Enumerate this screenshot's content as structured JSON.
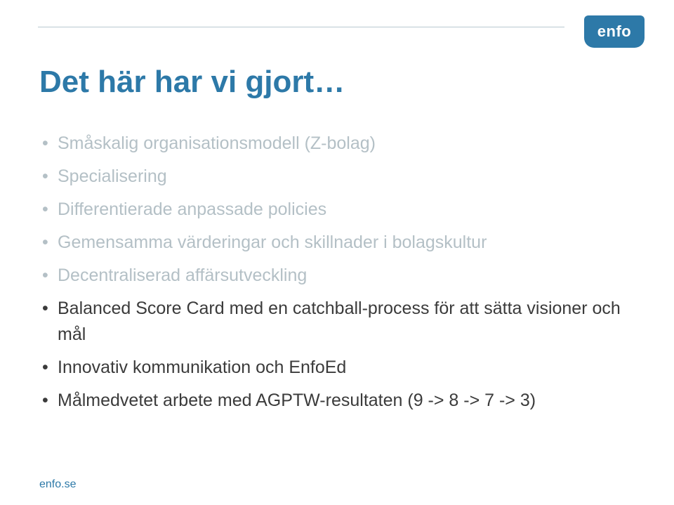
{
  "logo": {
    "text": "enfo"
  },
  "title": "Det här har vi gjort…",
  "bullets": [
    {
      "text": "Småskalig organisationsmodell (Z-bolag)",
      "dim": true
    },
    {
      "text": "Specialisering",
      "dim": true
    },
    {
      "text": "Differentierade anpassade policies",
      "dim": true
    },
    {
      "text": "Gemensamma värderingar och skillnader i bolagskultur",
      "dim": true
    },
    {
      "text": "Decentraliserad affärsutveckling",
      "dim": true
    },
    {
      "text": "Balanced Score Card med en catchball-process för att sätta visioner och mål",
      "dim": false
    },
    {
      "text": "Innovativ kommunikation och EnfoEd",
      "dim": false
    },
    {
      "text": "Målmedvetet arbete med AGPTW-resultaten (9 -> 8 -> 7 -> 3)",
      "dim": false
    }
  ],
  "footer": "enfo.se"
}
